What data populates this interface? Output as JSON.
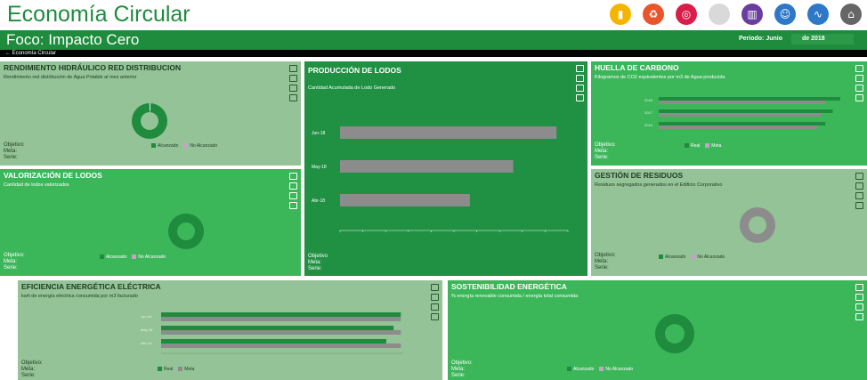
{
  "app": {
    "title": "Economía Circular",
    "focus": "Foco: Impacto Cero",
    "period_label": "Período: Junio",
    "year_label": "de 2018",
    "breadcrumb": "← Economía Circular",
    "icons": [
      {
        "name": "chart-icon",
        "color": "#f5b400",
        "glyph": "▮"
      },
      {
        "name": "recycle-icon",
        "color": "#e9542b",
        "glyph": "♻"
      },
      {
        "name": "target-icon",
        "color": "#d91d4a",
        "glyph": "◎"
      },
      {
        "name": "blank-icon",
        "color": "#d9d9d9",
        "glyph": ""
      },
      {
        "name": "building-icon",
        "color": "#6a3e9e",
        "glyph": "▥"
      },
      {
        "name": "people-icon",
        "color": "#2e78c8",
        "glyph": "☺"
      },
      {
        "name": "energy-icon",
        "color": "#2e78c8",
        "glyph": "∿"
      },
      {
        "name": "home-icon",
        "color": "#666666",
        "glyph": "⌂"
      }
    ]
  },
  "colors": {
    "green_dark": "#209043",
    "green_mid": "#3bb659",
    "green_light": "#93c396",
    "bar_green": "#1e8b3d",
    "bar_gray": "#8c8c8c"
  },
  "panels": {
    "rendimiento": {
      "title": "RENDIMIENTO HIDRÁULICO RED DISTRIBUCION",
      "subtitle": "Rendimiento red distribución de Agua Potable al mes anterior",
      "objetivo": "Objetivo:",
      "meta": "Meta:",
      "serie": "Serie:",
      "legend": [
        "Alcanzado",
        "No Alcanzado"
      ]
    },
    "produccion": {
      "title": "PRODUCCIÓN DE LODOS",
      "subtitle": "Cantidad Acumulada de Lodo Generado",
      "objetivo": "Objetivo",
      "meta": "Meta:",
      "serie": "Serie:"
    },
    "huella": {
      "title": "HUELLA DE CARBONO",
      "subtitle": "Kilogramos de CO2 equivalentes por m3 de Agua producida",
      "objetivo": "Objetivo:",
      "meta": "Meta:",
      "serie": "Serie:",
      "legend": [
        "Real",
        "Meta"
      ]
    },
    "valorizacion": {
      "title": "VALORIZACIÓN DE LODOS",
      "subtitle": "Cantidad de lodos valorizados",
      "objetivo": "Objetivo:",
      "meta": "Meta:",
      "serie": "Serie:",
      "legend": [
        "Alcanzado",
        "No Alcanzado"
      ]
    },
    "residuos": {
      "title": "GESTIÓN DE RESIDUOS",
      "subtitle": "Residuos segregados generados en el Edificio Corporativo",
      "objetivo": "Objetivo:",
      "meta": "Meta:",
      "serie": "Serie:",
      "legend": [
        "Alcanzado",
        "No Alcanzado"
      ]
    },
    "eficiencia": {
      "title": "EFICIENCIA ENERGÉTICA ELÉCTRICA",
      "subtitle": "kwh de energía eléctrica consumida por m3 facturado",
      "objetivo": "Objetivo:",
      "meta": "Meta:",
      "serie": "Serie:",
      "legend": [
        "Real",
        "Meta"
      ]
    },
    "sostenibilidad": {
      "title": "SOSTENIBILIDAD ENERGÉTICA",
      "subtitle": "% energía renovable consumida / energía total consumida",
      "objetivo": "Objetivo:",
      "meta": "Meta:",
      "serie": "Serie:",
      "legend": [
        "Alcanzado",
        "No Alcanzado"
      ]
    }
  },
  "chart_data": [
    {
      "panel": "produccion",
      "type": "bar",
      "orientation": "horizontal",
      "categories": [
        "Jun-18",
        "May-18",
        "Abr-18"
      ],
      "values": [
        0.95,
        0.76,
        0.57
      ],
      "xlim": [
        0,
        1
      ],
      "grid": false
    },
    {
      "panel": "huella",
      "type": "bar",
      "orientation": "horizontal",
      "categories": [
        "2018",
        "2017",
        "2016"
      ],
      "series": [
        {
          "name": "Real",
          "values": [
            0.98,
            0.94,
            0.9
          ]
        },
        {
          "name": "Meta",
          "values": [
            0.9,
            0.88,
            0.86
          ]
        }
      ],
      "xlim": [
        0,
        1
      ]
    },
    {
      "panel": "eficiencia",
      "type": "bar",
      "orientation": "horizontal",
      "categories": [
        "Jun-18",
        "May-18",
        "Abr-18"
      ],
      "series": [
        {
          "name": "Real",
          "values": [
            0.99,
            0.96,
            0.93
          ]
        },
        {
          "name": "Meta",
          "values": [
            0.99,
            0.99,
            0.99
          ]
        }
      ],
      "xlim": [
        0,
        1
      ]
    },
    {
      "panel": "rendimiento",
      "type": "pie",
      "series": [
        {
          "name": "Alcanzado",
          "values": [
            0.99
          ]
        },
        {
          "name": "No Alcanzado",
          "values": [
            0.01
          ]
        }
      ]
    },
    {
      "panel": "valorizacion",
      "type": "pie",
      "series": [
        {
          "name": "Alcanzado",
          "values": [
            1.0
          ]
        },
        {
          "name": "No Alcanzado",
          "values": [
            0
          ]
        }
      ]
    },
    {
      "panel": "residuos",
      "type": "pie",
      "series": [
        {
          "name": "Alcanzado",
          "values": [
            0
          ]
        },
        {
          "name": "No Alcanzado",
          "values": [
            1.0
          ]
        }
      ]
    },
    {
      "panel": "sostenibilidad",
      "type": "pie",
      "series": [
        {
          "name": "Alcanzado",
          "values": [
            1.0
          ]
        },
        {
          "name": "No Alcanzado",
          "values": [
            0
          ]
        }
      ]
    }
  ]
}
